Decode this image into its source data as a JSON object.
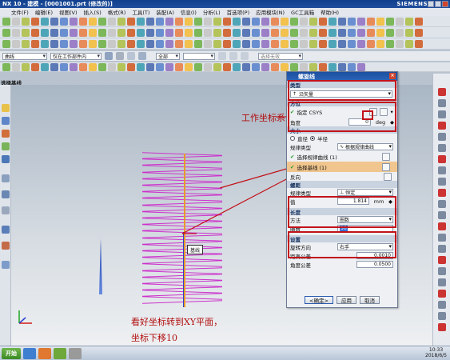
{
  "window": {
    "title": "NX 10 - 建模 - [0001001.prt (修改的)]",
    "brand": "SIEMENS"
  },
  "menubar": {
    "items": [
      "文件(F)",
      "编辑(E)",
      "视图(V)",
      "插入(S)",
      "格式(R)",
      "工具(T)",
      "装配(A)",
      "信息(I)",
      "分析(L)",
      "首选项(P)",
      "应用模块(N)",
      "GC工具箱",
      "帮助(H)"
    ]
  },
  "selectbar": {
    "filter": "曲线",
    "scope": "仅在工作部件内",
    "snap": "全部",
    "search_placeholder": "选择无效"
  },
  "viewport": {
    "label": "选择基线",
    "annot_box": "基线"
  },
  "annotations": {
    "coord": "工作坐标系",
    "note_line1": "看好坐标转到XY平面，",
    "note_line2": "坐标下移10"
  },
  "dialog": {
    "title": "螺旋线",
    "type_section": "类型",
    "type_value": "沿矢量",
    "orient_section": "方位",
    "csys_label": "指定 CSYS",
    "angle_label": "角度",
    "angle_value": "0",
    "angle_unit": "deg",
    "size_section": "大小",
    "radio_diameter": "直径",
    "radio_radius": "半径",
    "law_type_label": "规律类型",
    "law_type_value": "根据规律曲线",
    "select_law_curve": "选择规律曲线 (1)",
    "select_base_line": "选择基线 (1)",
    "reverse_label": "反向",
    "pitch_section": "螺距",
    "pitch_law_label": "规律类型",
    "pitch_law_value": "恒定",
    "pitch_value_label": "值",
    "pitch_value": "1.814",
    "pitch_unit": "mm",
    "length_section": "长度",
    "method_label": "方法",
    "method_value": "圈数",
    "turns_label": "圈数",
    "turns_value": "30",
    "settings_section": "设置",
    "rotation_label": "旋转方向",
    "rotation_value": "右手",
    "dist_tol_label": "距离公差",
    "dist_tol_value": "0.0010",
    "angle_tol_label": "角度公差",
    "angle_tol_value": "0.0500",
    "ok": "<确定>",
    "apply": "应用",
    "cancel": "取消"
  },
  "taskbar": {
    "start": "开始",
    "time": "10:33",
    "date": "2018/6/5"
  },
  "colors": {
    "title_bar": "#1c4f9e",
    "annotation": "#b10d0d",
    "helix": "#cc33cc",
    "highlight_row": "#f0c68e"
  }
}
